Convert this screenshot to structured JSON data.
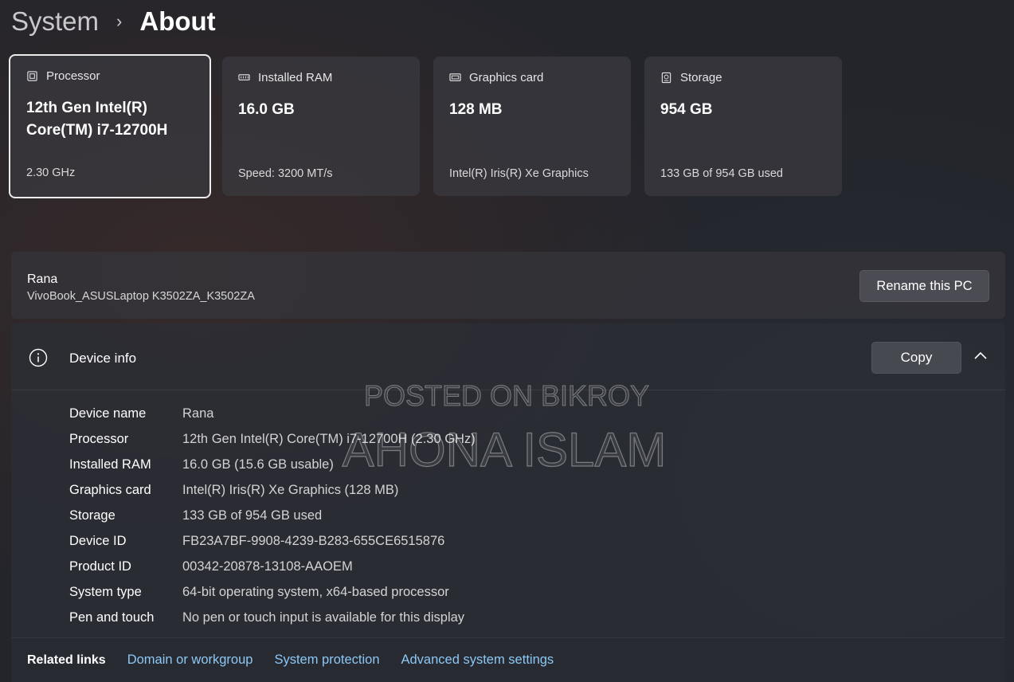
{
  "breadcrumb": {
    "parent": "System",
    "separator": "›",
    "current": "About"
  },
  "specs": [
    {
      "icon": "processor-icon",
      "label": "Processor",
      "value": "12th Gen Intel(R) Core(TM) i7-12700H",
      "sub": "2.30 GHz"
    },
    {
      "icon": "ram-icon",
      "label": "Installed RAM",
      "value": "16.0 GB",
      "sub": "Speed: 3200 MT/s"
    },
    {
      "icon": "graphics-card-icon",
      "label": "Graphics card",
      "value": "128 MB",
      "sub": "Intel(R) Iris(R) Xe Graphics"
    },
    {
      "icon": "storage-icon",
      "label": "Storage",
      "value": "954 GB",
      "sub": "133 GB of 954 GB used"
    }
  ],
  "pc": {
    "name": "Rana",
    "model": "VivoBook_ASUSLaptop K3502ZA_K3502ZA",
    "rename_label": "Rename this PC"
  },
  "device_info": {
    "title": "Device info",
    "copy_label": "Copy",
    "rows": [
      {
        "label": "Device name",
        "value": "Rana"
      },
      {
        "label": "Processor",
        "value": "12th Gen Intel(R) Core(TM) i7-12700H (2.30 GHz)"
      },
      {
        "label": "Installed RAM",
        "value": "16.0 GB (15.6 GB usable)"
      },
      {
        "label": "Graphics card",
        "value": "Intel(R) Iris(R) Xe Graphics (128 MB)"
      },
      {
        "label": "Storage",
        "value": "133 GB of 954 GB used"
      },
      {
        "label": "Device ID",
        "value": "FB23A7BF-9908-4239-B283-655CE6515876"
      },
      {
        "label": "Product ID",
        "value": "00342-20878-13108-AAOEM"
      },
      {
        "label": "System type",
        "value": "64-bit operating system, x64-based processor"
      },
      {
        "label": "Pen and touch",
        "value": "No pen or touch input is available for this display"
      }
    ]
  },
  "related": {
    "title": "Related links",
    "links": [
      "Domain or workgroup",
      "System protection",
      "Advanced system settings"
    ]
  },
  "watermark": {
    "line1": "POSTED ON BIKROY",
    "line2": "AHONA ISLAM"
  },
  "colors": {
    "link": "#8cc8f5",
    "card_bg": "#3a3a40",
    "panel_bg": "#2c2e36"
  }
}
